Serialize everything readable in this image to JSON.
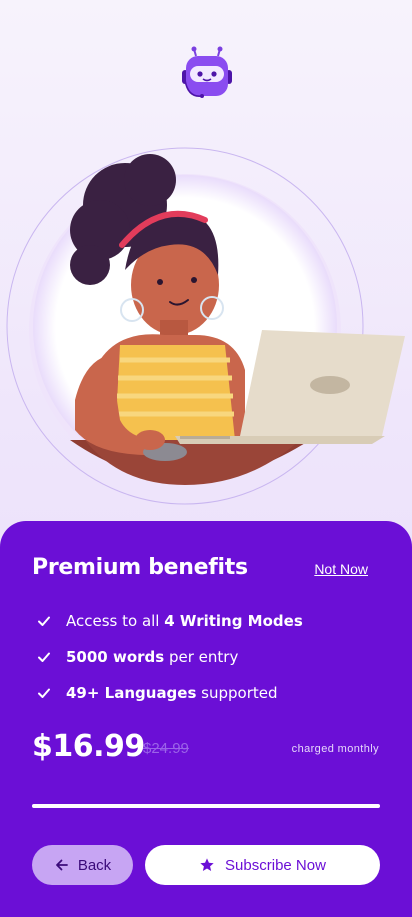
{
  "mascot": {
    "icon": "robot-mascot-icon"
  },
  "hero": {
    "icon": "woman-at-laptop-illustration"
  },
  "sheet": {
    "title": "Premium benefits",
    "not_now": "Not Now",
    "benefits": [
      {
        "pre": "Access to all ",
        "bold": "4 Writing Modes",
        "post": ""
      },
      {
        "pre": "",
        "bold": "5000 words",
        "post": " per entry"
      },
      {
        "pre": "",
        "bold": "49+ Languages",
        "post": " supported"
      }
    ],
    "price": "$16.99",
    "old_price": "$24.99",
    "period": "charged monthly",
    "progress": 1.0,
    "back_label": "Back",
    "subscribe_label": "Subscribe Now"
  },
  "colors": {
    "sheet": "#6b0fd6",
    "accent_light": "#c7a5f3"
  }
}
